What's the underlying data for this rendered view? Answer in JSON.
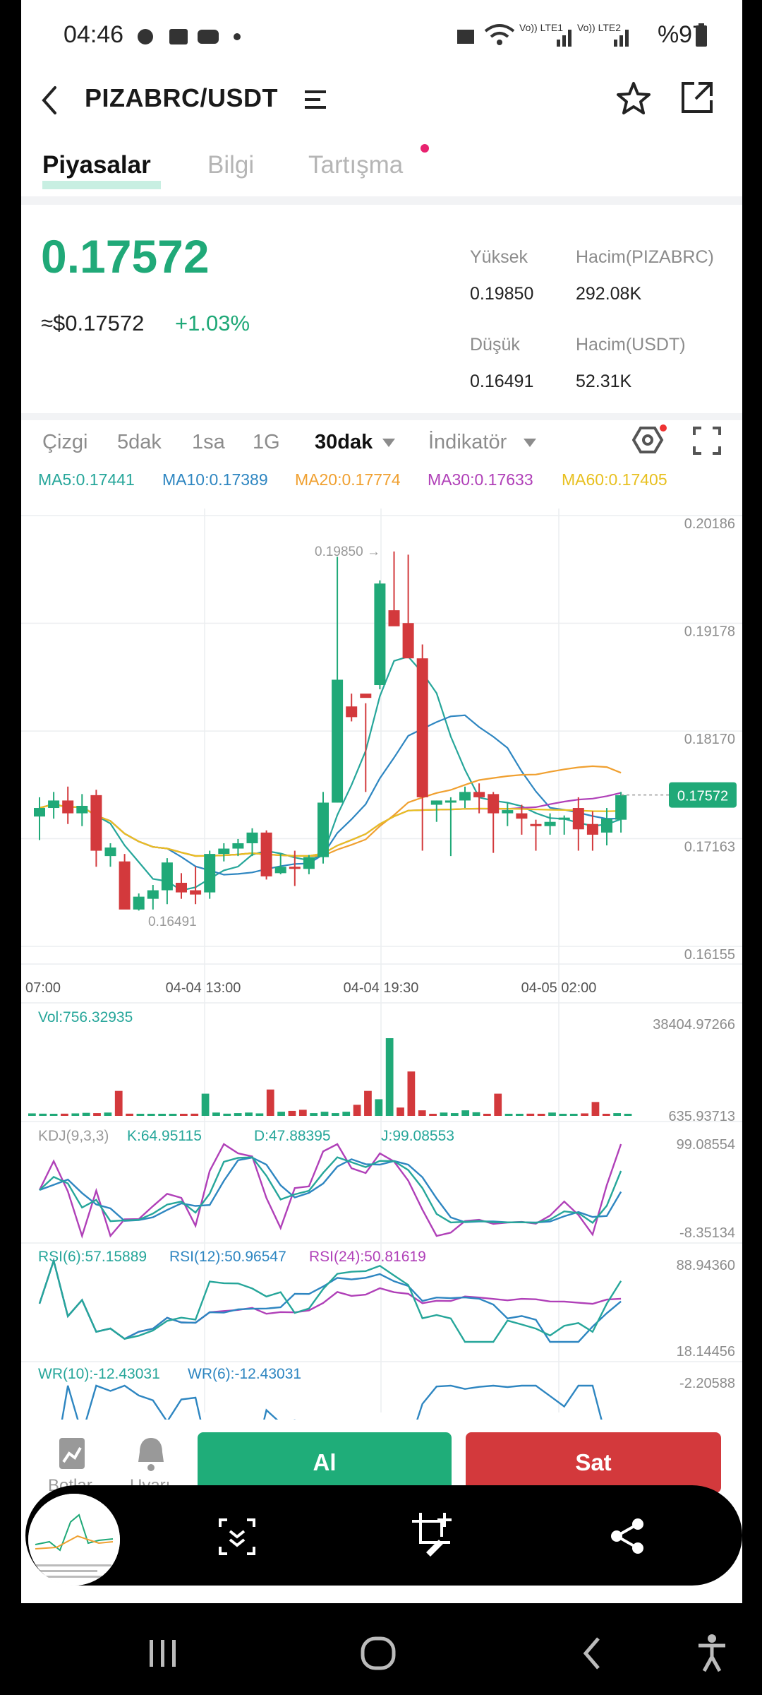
{
  "status_bar": {
    "time": "04:46",
    "network_1": "Vo)) LTE1",
    "network_2": "Vo)) LTE2",
    "battery": "%97"
  },
  "header": {
    "pair": "PIZABRC/USDT",
    "back_icon": "chevron-left-icon",
    "menu_icon": "menu-icon",
    "favorite_icon": "star-icon",
    "share_icon": "external-link-icon"
  },
  "tabs": [
    {
      "label": "Piyasalar",
      "active": true
    },
    {
      "label": "Bilgi",
      "active": false
    },
    {
      "label": "Tartışma",
      "active": false,
      "has_dot": true
    }
  ],
  "ticker": {
    "last_price": "0.17572",
    "fiat_price": "≈$0.17572",
    "change": "+1.03%",
    "high_label": "Yüksek",
    "high_value": "0.19850",
    "low_label": "Düşük",
    "low_value": "0.16491",
    "vol_base_label": "Hacim(PIZABRC)",
    "vol_base_value": "292.08K",
    "vol_quote_label": "Hacim(USDT)",
    "vol_quote_value": "52.31K"
  },
  "intervals": [
    {
      "label": "Çizgi",
      "active": false
    },
    {
      "label": "5dak",
      "active": false
    },
    {
      "label": "1sa",
      "active": false
    },
    {
      "label": "1G",
      "active": false
    },
    {
      "label": "30dak",
      "active": true,
      "dropdown": true
    },
    {
      "label": "İndikatör",
      "active": false,
      "dropdown": true
    }
  ],
  "ma_legend": [
    {
      "label": "MA5:0.17441",
      "color": "#26a69a"
    },
    {
      "label": "MA10:0.17389",
      "color": "#2e86c1"
    },
    {
      "label": "MA20:0.17774",
      "color": "#f0a030"
    },
    {
      "label": "MA30:0.17633",
      "color": "#b040b8"
    },
    {
      "label": "MA60:0.17405",
      "color": "#e8c020"
    }
  ],
  "colors": {
    "up": "#20a978",
    "down": "#d3393c",
    "ma5": "#26a69a",
    "ma10": "#2e86c1",
    "ma20": "#f0a030",
    "ma30": "#b040b8",
    "ma60": "#e8c020"
  },
  "chart_data": {
    "type": "candlestick",
    "interval": "30dak",
    "ylim": [
      0.16155,
      0.20186
    ],
    "y_ticks": [
      "0.20186",
      "0.19178",
      "0.18170",
      "0.17163",
      "0.16155"
    ],
    "x_ticks": [
      "07:00",
      "04-04 13:00",
      "04-04 19:30",
      "04-05 02:00"
    ],
    "last_price_label": "0.17572",
    "last_price": 0.17572,
    "high_marker": "0.19850 →",
    "high": 0.1985,
    "low_marker": "0.16491",
    "low": 0.16491,
    "candles": [
      {
        "o": 0.1737,
        "h": 0.1755,
        "l": 0.1715,
        "c": 0.1745
      },
      {
        "o": 0.1745,
        "h": 0.176,
        "l": 0.1735,
        "c": 0.1752
      },
      {
        "o": 0.1752,
        "h": 0.1765,
        "l": 0.173,
        "c": 0.174
      },
      {
        "o": 0.174,
        "h": 0.1758,
        "l": 0.1728,
        "c": 0.1747
      },
      {
        "o": 0.1757,
        "h": 0.1762,
        "l": 0.169,
        "c": 0.1705
      },
      {
        "o": 0.17,
        "h": 0.1712,
        "l": 0.169,
        "c": 0.1708
      },
      {
        "o": 0.1695,
        "h": 0.1702,
        "l": 0.1652,
        "c": 0.165
      },
      {
        "o": 0.165,
        "h": 0.1665,
        "l": 0.1649,
        "c": 0.1662
      },
      {
        "o": 0.166,
        "h": 0.1673,
        "l": 0.165,
        "c": 0.1668
      },
      {
        "o": 0.1668,
        "h": 0.1698,
        "l": 0.1655,
        "c": 0.1694
      },
      {
        "o": 0.1675,
        "h": 0.1684,
        "l": 0.166,
        "c": 0.1666
      },
      {
        "o": 0.1668,
        "h": 0.169,
        "l": 0.1655,
        "c": 0.1664
      },
      {
        "o": 0.1666,
        "h": 0.1705,
        "l": 0.166,
        "c": 0.1702
      },
      {
        "o": 0.1702,
        "h": 0.1712,
        "l": 0.1695,
        "c": 0.1707
      },
      {
        "o": 0.1707,
        "h": 0.1716,
        "l": 0.17,
        "c": 0.1712
      },
      {
        "o": 0.1712,
        "h": 0.1726,
        "l": 0.17,
        "c": 0.1722
      },
      {
        "o": 0.1722,
        "h": 0.1724,
        "l": 0.1678,
        "c": 0.1681
      },
      {
        "o": 0.1684,
        "h": 0.1702,
        "l": 0.1683,
        "c": 0.169
      },
      {
        "o": 0.169,
        "h": 0.1705,
        "l": 0.1672,
        "c": 0.1688
      },
      {
        "o": 0.1688,
        "h": 0.1701,
        "l": 0.1683,
        "c": 0.1699
      },
      {
        "o": 0.1699,
        "h": 0.176,
        "l": 0.1693,
        "c": 0.175
      },
      {
        "o": 0.175,
        "h": 0.198,
        "l": 0.175,
        "c": 0.1865
      },
      {
        "o": 0.184,
        "h": 0.1852,
        "l": 0.1826,
        "c": 0.183
      },
      {
        "o": 0.1852,
        "h": 0.1843,
        "l": 0.176,
        "c": 0.1848
      },
      {
        "o": 0.186,
        "h": 0.1958,
        "l": 0.1856,
        "c": 0.1955
      },
      {
        "o": 0.193,
        "h": 0.1985,
        "l": 0.192,
        "c": 0.1915
      },
      {
        "o": 0.1918,
        "h": 0.1982,
        "l": 0.1886,
        "c": 0.1885
      },
      {
        "o": 0.1885,
        "h": 0.1898,
        "l": 0.1705,
        "c": 0.1755
      },
      {
        "o": 0.1748,
        "h": 0.1752,
        "l": 0.1732,
        "c": 0.1752
      },
      {
        "o": 0.175,
        "h": 0.1755,
        "l": 0.17,
        "c": 0.1752
      },
      {
        "o": 0.1752,
        "h": 0.1765,
        "l": 0.1745,
        "c": 0.176
      },
      {
        "o": 0.176,
        "h": 0.1768,
        "l": 0.174,
        "c": 0.1755
      },
      {
        "o": 0.1758,
        "h": 0.176,
        "l": 0.1703,
        "c": 0.174
      },
      {
        "o": 0.174,
        "h": 0.175,
        "l": 0.1728,
        "c": 0.1743
      },
      {
        "o": 0.174,
        "h": 0.1748,
        "l": 0.172,
        "c": 0.1735
      },
      {
        "o": 0.173,
        "h": 0.1734,
        "l": 0.1705,
        "c": 0.1728
      },
      {
        "o": 0.1728,
        "h": 0.174,
        "l": 0.172,
        "c": 0.1732
      },
      {
        "o": 0.1734,
        "h": 0.1738,
        "l": 0.172,
        "c": 0.1736
      },
      {
        "o": 0.1745,
        "h": 0.1755,
        "l": 0.1705,
        "c": 0.1725
      },
      {
        "o": 0.173,
        "h": 0.1742,
        "l": 0.1705,
        "c": 0.172
      },
      {
        "o": 0.1722,
        "h": 0.1745,
        "l": 0.171,
        "c": 0.1735
      },
      {
        "o": 0.1734,
        "h": 0.176,
        "l": 0.1722,
        "c": 0.1757
      }
    ],
    "volume_panel": {
      "label": "Vol:756.32935",
      "max_label": "38404.97266",
      "min_label": "635.93713",
      "values": [
        900,
        800,
        700,
        800,
        900,
        1100,
        1000,
        1200,
        9000,
        800,
        700,
        600,
        700,
        600,
        700,
        800,
        8000,
        1200,
        800,
        1000,
        1200,
        900,
        9500,
        1500,
        1800,
        2200,
        1000,
        1500,
        1000,
        1500,
        4000,
        9000,
        6000,
        28000,
        3000,
        16000,
        2000,
        700,
        1200,
        1000,
        2000,
        1300,
        700,
        8000,
        600,
        700,
        800,
        600,
        1200,
        600,
        500,
        900,
        5000,
        600,
        1000,
        700
      ]
    },
    "kdj_panel": {
      "label": "KDJ(9,3,3)",
      "k": "K:64.95115",
      "d": "D:47.88395",
      "j": "J:99.08553",
      "max_label": "99.08554",
      "min_label": "-8.35134"
    },
    "rsi_panel": {
      "rsi6": "RSI(6):57.15889",
      "rsi12": "RSI(12):50.96547",
      "rsi24": "RSI(24):50.81619",
      "max_label": "88.94360",
      "min_label": "18.14456"
    },
    "wr_panel": {
      "wr10": "WR(10):-12.43031",
      "wr6": "WR(6):-12.43031",
      "max_label": "-2.20588"
    }
  },
  "actions": {
    "buy": "Al",
    "sell": "Sat",
    "left_1": "Botlar",
    "left_2": "Uyarı"
  },
  "screenshot_toolbar": {
    "scroll_capture_icon": "scroll-capture-icon",
    "crop_edit_icon": "crop-edit-icon",
    "share_icon": "share-icon"
  },
  "nav_bar": {
    "recents_icon": "recents-icon",
    "home_icon": "home-icon",
    "back_icon": "back-icon",
    "accessibility_icon": "accessibility-icon"
  }
}
